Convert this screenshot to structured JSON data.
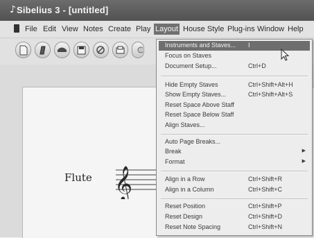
{
  "window": {
    "title": "Sibelius 3 - [untitled]"
  },
  "menubar": {
    "items": [
      {
        "label": "File"
      },
      {
        "label": "Edit"
      },
      {
        "label": "View"
      },
      {
        "label": "Notes"
      },
      {
        "label": "Create"
      },
      {
        "label": "Play"
      },
      {
        "label": "Layout",
        "active": true
      },
      {
        "label": "House Style"
      },
      {
        "label": "Plug-ins"
      },
      {
        "label": "Window"
      },
      {
        "label": "Help"
      }
    ]
  },
  "toolbar": {
    "icons": [
      "new-icon",
      "open-icon",
      "close-icon",
      "save-icon",
      "print-icon",
      "print-preview-icon"
    ]
  },
  "score": {
    "instrument": "Flute"
  },
  "layout_menu": {
    "items": [
      {
        "label": "Instruments and Staves...",
        "shortcut": "I",
        "highlight": true
      },
      {
        "label": "Focus on Staves",
        "shortcut": ""
      },
      {
        "label": "Document Setup...",
        "shortcut": "Ctrl+D"
      },
      {
        "label": "Hide Empty Staves",
        "shortcut": "Ctrl+Shift+Alt+H"
      },
      {
        "label": "Show Empty Staves...",
        "shortcut": "Ctrl+Shift+Alt+S"
      },
      {
        "label": "Reset Space Above Staff",
        "shortcut": ""
      },
      {
        "label": "Reset Space Below Staff",
        "shortcut": ""
      },
      {
        "label": "Align Staves...",
        "shortcut": ""
      },
      {
        "label": "Auto Page Breaks...",
        "shortcut": ""
      },
      {
        "label": "Break",
        "shortcut": "",
        "submenu": true
      },
      {
        "label": "Format",
        "shortcut": "",
        "submenu": true
      },
      {
        "label": "Align in a Row",
        "shortcut": "Ctrl+Shift+R"
      },
      {
        "label": "Align in a Column",
        "shortcut": "Ctrl+Shift+C"
      },
      {
        "label": "Reset Position",
        "shortcut": "Ctrl+Shift+P"
      },
      {
        "label": "Reset Design",
        "shortcut": "Ctrl+Shift+D"
      },
      {
        "label": "Reset Note Spacing",
        "shortcut": "Ctrl+Shift+N"
      }
    ]
  },
  "colors": {
    "highlight": "#6c6c6c",
    "titlebar": "#555555",
    "menu_bg": "#f7f7f7"
  }
}
